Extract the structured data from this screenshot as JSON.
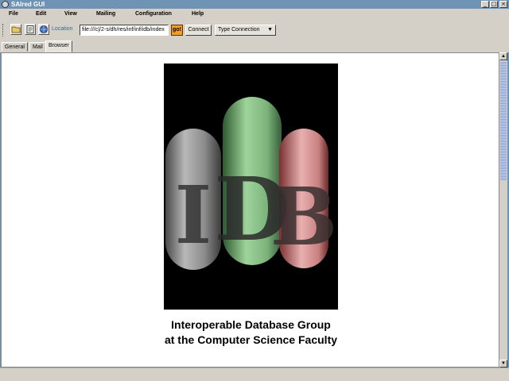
{
  "window": {
    "title": "SAIred GUI",
    "buttons": {
      "minimize": "_",
      "maximize": "□",
      "close": "×"
    }
  },
  "menu": [
    {
      "label": "File"
    },
    {
      "label": "Edit"
    },
    {
      "label": "View"
    },
    {
      "label": "Mailing"
    },
    {
      "label": "Configuration"
    },
    {
      "label": "Help"
    }
  ],
  "toolbar": {
    "location_label": "Location",
    "location_value": "file:///c|/2-s/dh/res/inf/inf/idb/index",
    "go_label": "go!",
    "connect_label": "Connect",
    "connection_select": "Type Connection"
  },
  "tabs": [
    {
      "label": "General",
      "active": false
    },
    {
      "label": "Mail",
      "active": false
    },
    {
      "label": "Browser",
      "active": true
    }
  ],
  "logo": {
    "letters": "IDB"
  },
  "caption": {
    "line1": "Interoperable Database Group",
    "line2": "at the Computer Science Faculty"
  },
  "colors": {
    "titlebar": "#6f93b4",
    "chrome": "#d4d0c8",
    "go_button": "#f0a020",
    "location_label": "#3b5fa5"
  }
}
